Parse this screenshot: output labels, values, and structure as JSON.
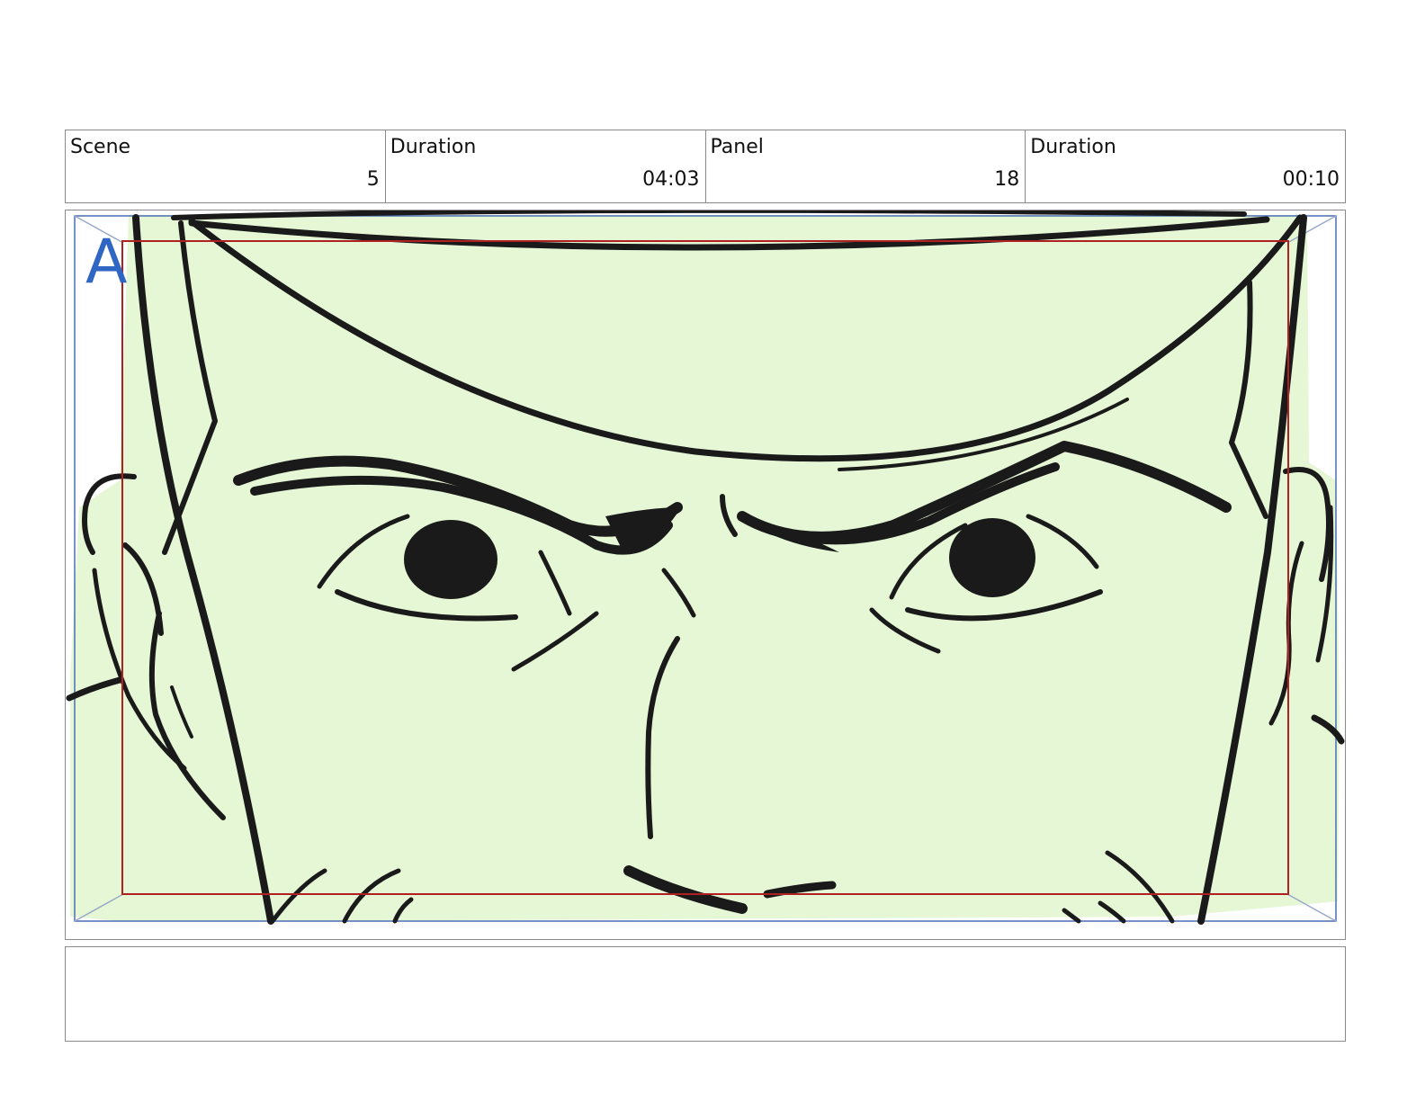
{
  "header": {
    "scene_label": "Scene",
    "scene_value": "5",
    "duration_label": "Duration",
    "duration_value": "04:03",
    "panel_label": "Panel",
    "panel_value": "18",
    "panel_duration_label": "Duration",
    "panel_duration_value": "00:10"
  },
  "panel": {
    "layer_label": "A",
    "colors": {
      "fill": "#e6f7d6",
      "ink": "#1a1a1a",
      "camera_frame": "#4a6fb5",
      "safe_frame": "#b02020"
    }
  },
  "notes": {
    "text": ""
  }
}
